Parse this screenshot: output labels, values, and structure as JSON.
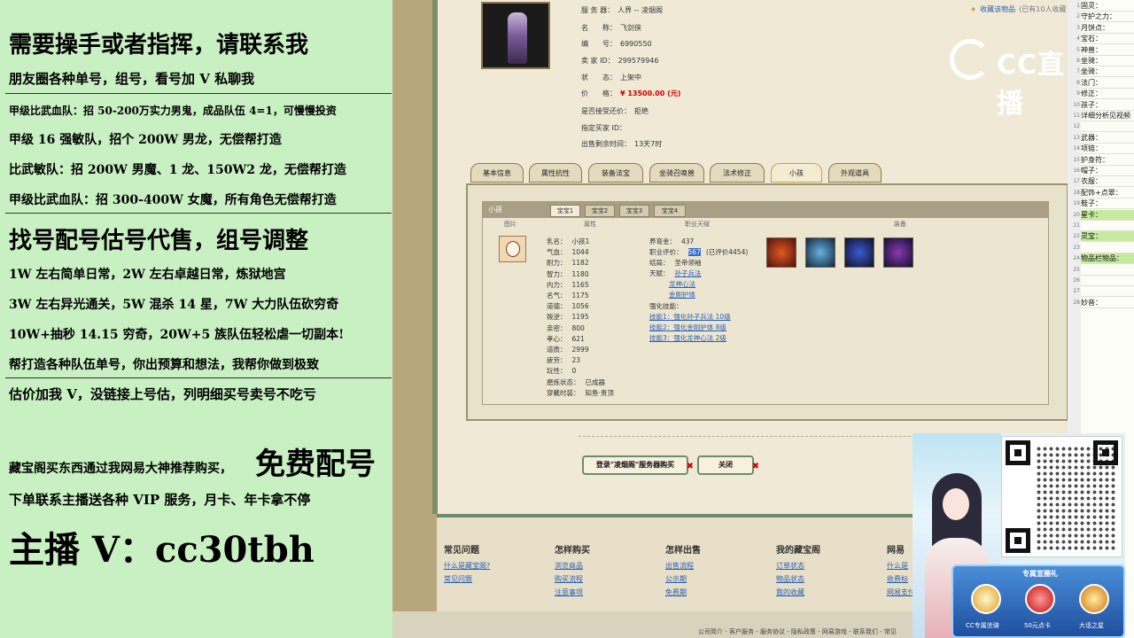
{
  "stream_ads": {
    "line1": "需要操手或者指挥，请联系我",
    "line2": "朋友圈各种单号，组号，看号加 V 私聊我",
    "line3": "甲级比武血队：招 50-200万实力男鬼，成品队伍 4=1，可慢慢投资",
    "line4": "甲级 16 强敏队，招个 200W 男龙，无偿帮打造",
    "line5": "比武敏队：招 200W 男魔、1 龙、150W2 龙，无偿帮打造",
    "line6": "甲级比武血队：招 300-400W 女魔，所有角色无偿帮打造",
    "line7": "找号配号估号代售，组号调整",
    "line8": "1W 左右简单日常，2W 左右卓越日常，炼狱地宫",
    "line9": "3W 左右异光通关，5W 混杀 14 星，7W 大力队伍砍穷奇",
    "line10": "10W+抽秒 14.15 穷奇，20W+5 族队伍轻松虐一切副本!",
    "line11": "帮打造各种队伍单号，你出预算和想法，我帮你做到极致",
    "line12": "估价加我 V，没链接上号估，列明细买号卖号不吃亏",
    "line13a": "藏宝阁买东西通过我网易大神推荐购买，",
    "line13b": "免费配号",
    "line14": "下单联系主播送各种 VIP 服务，月卡、年卡拿不停",
    "line15": "主播 V：cc30tbh"
  },
  "listing": {
    "server_label": "服 务 器：",
    "server": "人界 -- 凌烟阁",
    "name_label": "名　　称：",
    "name": "飞剑侠",
    "id_label": "编　　号：",
    "id": "6990550",
    "seller_label": "卖 家 ID：",
    "seller_id": "299579946",
    "status_label": "状　　态：",
    "status": "上架中",
    "price_label": "价　　格：",
    "price": "¥ 13500.00 (元)",
    "counter_label": "是否接受还价：",
    "counter": "拒绝",
    "buyer_label": "指定买家 ID：",
    "buyer": "",
    "time_label": "出售剩余时间：",
    "time": "13天7时",
    "fav": "收藏该物品",
    "fav_note": "(已有10人收藏"
  },
  "tabs": [
    "基本信息",
    "属性抗性",
    "装备法宝",
    "坐骑召唤兽",
    "法术修正",
    "小孩",
    "外观道具"
  ],
  "child_panel": {
    "title": "小孩",
    "subtabs": [
      "宝宝1",
      "宝宝2",
      "宝宝3",
      "宝宝4"
    ],
    "col_image": "图片",
    "col_attr": "属性",
    "col_skill": "职业天赋",
    "col_equip": "装备",
    "stats": [
      {
        "k": "乳名：",
        "v": "小孩1"
      },
      {
        "k": "气血：",
        "v": "1044"
      },
      {
        "k": "耐力：",
        "v": "1182"
      },
      {
        "k": "智力：",
        "v": "1180"
      },
      {
        "k": "内力：",
        "v": "1165"
      },
      {
        "k": "名气：",
        "v": "1175"
      },
      {
        "k": "道德：",
        "v": "1056"
      },
      {
        "k": "叛逆：",
        "v": "1195"
      },
      {
        "k": "亲密：",
        "v": "800"
      },
      {
        "k": "孝心：",
        "v": "621"
      },
      {
        "k": "道质：",
        "v": "2999"
      },
      {
        "k": "疲劳：",
        "v": "23"
      },
      {
        "k": "玩性：",
        "v": "0"
      },
      {
        "k": "磨炼状态：",
        "v": "已成器"
      },
      {
        "k": "穿戴时装：",
        "v": "知鱼·贵顶"
      }
    ],
    "nurture_label": "养育金：",
    "nurture": "437",
    "career_label": "职业评价：",
    "career": "567",
    "career_note": "(已评价4454)",
    "school_label": "结局：",
    "school": "圣帝领袖",
    "talent_label": "天赋：",
    "talents": [
      "孙子兵法",
      "龙神心法",
      "金刚护体"
    ],
    "enhance_label": "强化技能：",
    "enhances": [
      "技能1：强化孙子兵法 10级",
      "技能2：强化金刚护体 8级",
      "技能3：强化龙神心法 2级"
    ]
  },
  "buttons": {
    "login_buy": "登录\"凌烟阁\"服务器购买",
    "close": "关闭"
  },
  "footer": {
    "cols": [
      {
        "h": "常见问题",
        "links": [
          "什么是藏宝阁?",
          "常见问题"
        ]
      },
      {
        "h": "怎样购买",
        "links": [
          "浏览商品",
          "购买流程",
          "注意事项"
        ]
      },
      {
        "h": "怎样出售",
        "links": [
          "出售流程",
          "公示期",
          "免费期"
        ]
      },
      {
        "h": "我的藏宝阁",
        "links": [
          "订单状态",
          "物品状态",
          "我的收藏"
        ]
      },
      {
        "h": "网易",
        "links": [
          "什么是",
          "收费标",
          "网易支付"
        ]
      }
    ],
    "bottom_text": "公司简介 - 客户服务 - 服务协议 - 隐私政策 - 网易游戏 - 联系我们 - 常见"
  },
  "logo": {
    "text": "CC直播"
  },
  "checklist": [
    "固灵：",
    "守护之力：",
    "月饼点：",
    "宝石：",
    "神兽：",
    "坐骑：",
    "坐骑：",
    "法门：",
    "修正：",
    "孩子：",
    "详细分析见视频",
    "",
    "武器：",
    "项链：",
    "护身符：",
    "帽子：",
    "衣服：",
    "配饰+点翠：",
    "鞋子：",
    "星卡：",
    "",
    "灵宝：",
    "",
    "物品栏物品：",
    "",
    "",
    "",
    "妙音："
  ],
  "checklist_highlight": [
    19,
    21,
    23
  ],
  "promo": {
    "card_title": "专属宣圈礼",
    "item1": "CC专属坐骑",
    "item2": "50元点卡",
    "item3": "大话之星"
  }
}
